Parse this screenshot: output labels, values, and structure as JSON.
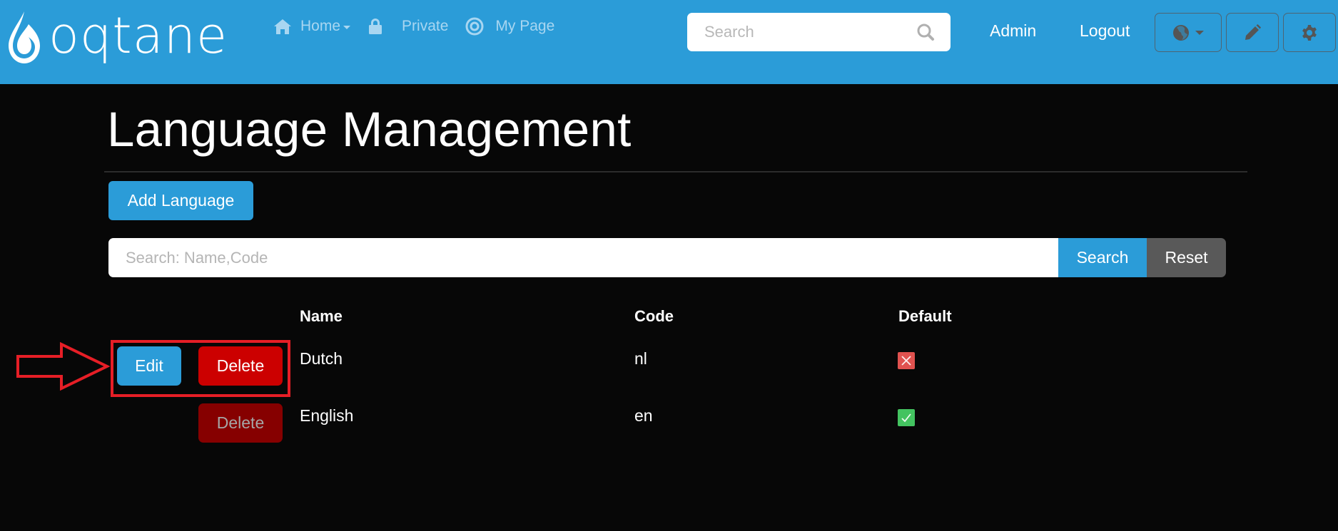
{
  "header": {
    "logo_text": "oqtane",
    "nav": [
      {
        "label": "Home",
        "icon": "home-icon",
        "has_dropdown": true
      },
      {
        "label": "Private",
        "icon": "lock-icon",
        "has_dropdown": false
      },
      {
        "label": "My Page",
        "icon": "target-icon",
        "has_dropdown": false
      }
    ],
    "search": {
      "placeholder": "Search",
      "value": ""
    },
    "user_links": {
      "admin": "Admin",
      "logout": "Logout"
    },
    "tools": [
      {
        "name": "language-selector",
        "icon": "globe-icon"
      },
      {
        "name": "edit-mode",
        "icon": "pencil-icon"
      },
      {
        "name": "control-panel",
        "icon": "gear-icon"
      }
    ],
    "colors": {
      "header_bg": "#2b9cd8"
    }
  },
  "page": {
    "title": "Language Management",
    "add_button": "Add Language",
    "search": {
      "placeholder": "Search: Name,Code",
      "value": "",
      "search_button": "Search",
      "reset_button": "Reset"
    },
    "table": {
      "columns": [
        "",
        "Name",
        "Code",
        "Default"
      ],
      "rows": [
        {
          "name": "Dutch",
          "code": "nl",
          "default": false,
          "actions": {
            "edit": "Edit",
            "delete": "Delete",
            "delete_enabled": true,
            "highlighted": true
          }
        },
        {
          "name": "English",
          "code": "en",
          "default": true,
          "actions": {
            "edit": null,
            "delete": "Delete",
            "delete_enabled": false,
            "highlighted": false
          }
        }
      ]
    }
  },
  "annotation": {
    "type": "arrow-and-box",
    "color": "#e61e26",
    "target": "row 1 actions"
  }
}
